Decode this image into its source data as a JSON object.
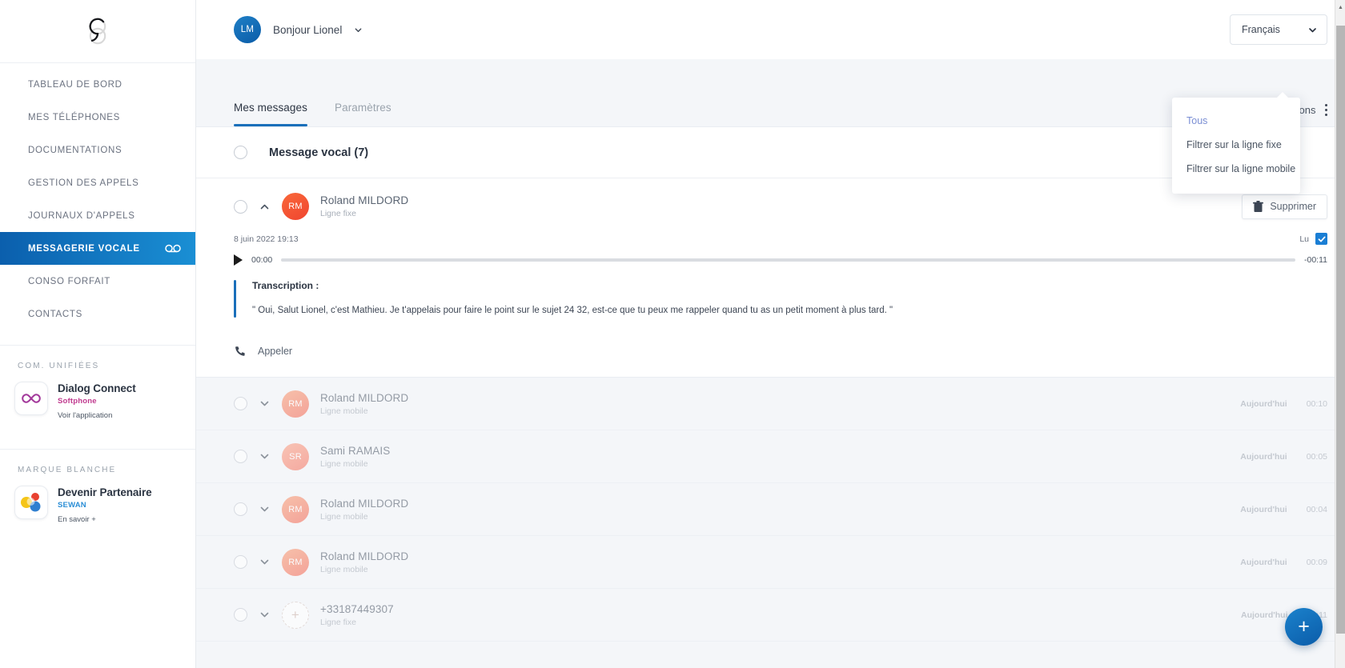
{
  "sidebar": {
    "logo_name": "sewan-logo",
    "nav": [
      {
        "label": "TABLEAU DE BORD",
        "active": false
      },
      {
        "label": "MES TÉLÉPHONES",
        "active": false
      },
      {
        "label": "DOCUMENTATIONS",
        "active": false
      },
      {
        "label": "GESTION DES APPELS",
        "active": false
      },
      {
        "label": "JOURNAUX D'APPELS",
        "active": false
      },
      {
        "label": "MESSAGERIE VOCALE",
        "active": true
      },
      {
        "label": "CONSO FORFAIT",
        "active": false
      },
      {
        "label": "CONTACTS",
        "active": false
      }
    ],
    "active_item_icon": "voicemail-icon",
    "sections": [
      {
        "label": "COM. UNIFIÉES",
        "card_title": "Dialog Connect",
        "card_sub": "Softphone",
        "card_link": "Voir l'application",
        "icon": "infinity-icon"
      },
      {
        "label": "MARQUE BLANCHE",
        "card_title": "Devenir Partenaire",
        "card_sub": "SEWAN",
        "card_link": "En savoir +",
        "icon": "partner-icon"
      }
    ]
  },
  "topbar": {
    "avatar_initials": "LM",
    "greeting": "Bonjour Lionel",
    "language": "Français"
  },
  "tabs": [
    {
      "label": "Mes messages",
      "active": true
    },
    {
      "label": "Paramètres",
      "active": false
    }
  ],
  "options": {
    "label": "Options",
    "menu": [
      {
        "label": "Tous",
        "selected": true
      },
      {
        "label": "Filtrer sur la ligne fixe",
        "selected": false
      },
      {
        "label": "Filtrer sur la ligne mobile",
        "selected": false
      }
    ]
  },
  "group": {
    "title": "Message vocal (7)"
  },
  "expanded_message": {
    "name": "Roland MILDORD",
    "line": "Ligne fixe",
    "initials": "RM",
    "timestamp": "8 juin 2022 19:13",
    "delete_label": "Supprimer",
    "read_label": "Lu",
    "read_checked": true,
    "current_time": "00:00",
    "remaining_time": "-00:11",
    "transcription_title": "Transcription :",
    "transcription_body": "\" Oui, Salut Lionel, c'est Mathieu. Je t'appelais pour faire le point sur le sujet 24 32, est-ce que tu peux me rappeler quand tu as un petit moment à plus tard. \"",
    "call_label": "Appeler"
  },
  "messages": [
    {
      "name": "Roland MILDORD",
      "line": "Ligne mobile",
      "initials": "RM",
      "day": "Aujourd'hui",
      "duration": "00:10",
      "avatar": "av-soft"
    },
    {
      "name": "Sami RAMAIS",
      "line": "Ligne mobile",
      "initials": "SR",
      "day": "Aujourd'hui",
      "duration": "00:05",
      "avatar": "av-soft2"
    },
    {
      "name": "Roland MILDORD",
      "line": "Ligne mobile",
      "initials": "RM",
      "day": "Aujourd'hui",
      "duration": "00:04",
      "avatar": "av-soft"
    },
    {
      "name": "Roland MILDORD",
      "line": "Ligne mobile",
      "initials": "RM",
      "day": "Aujourd'hui",
      "duration": "00:09",
      "avatar": "av-soft"
    },
    {
      "name": "+33187449307",
      "line": "Ligne fixe",
      "initials": "+",
      "day": "Aujourd'hui",
      "duration": "00:11",
      "avatar": "av-plus"
    }
  ],
  "fab": {
    "label": "+"
  },
  "colors": {
    "accent": "#1a6fba",
    "sidebar_active_from": "#0b5fad",
    "sidebar_active_to": "#1a8fd4",
    "avatar_hot": "#f4582f",
    "checkbox": "#1a7ed4"
  }
}
